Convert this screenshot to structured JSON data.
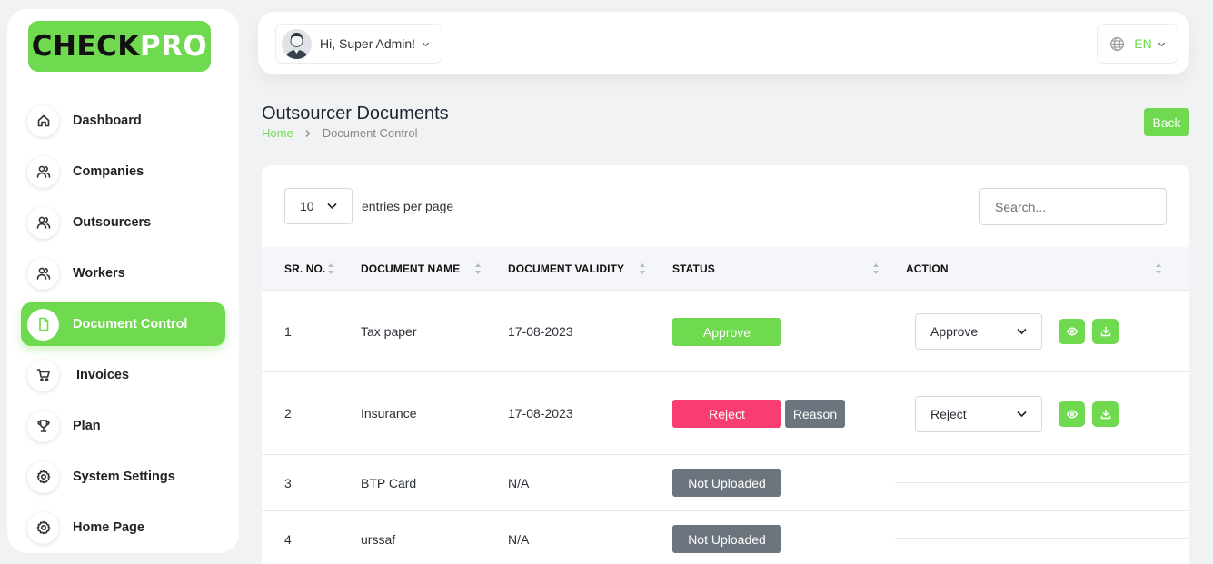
{
  "brand": {
    "part1": "CHECK",
    "part2": "PRO"
  },
  "sidebar": {
    "items": [
      {
        "label": "Dashboard",
        "icon": "home-icon"
      },
      {
        "label": "Companies",
        "icon": "users-icon"
      },
      {
        "label": "Outsourcers",
        "icon": "users-icon"
      },
      {
        "label": "Workers",
        "icon": "users-icon"
      },
      {
        "label": "Document Control",
        "icon": "file-icon",
        "active": true
      },
      {
        "label": "Invoices",
        "icon": "cart-icon"
      },
      {
        "label": "Plan",
        "icon": "trophy-icon"
      },
      {
        "label": "System Settings",
        "icon": "gear-icon"
      },
      {
        "label": "Home Page",
        "icon": "gear-icon"
      }
    ]
  },
  "topbar": {
    "greeting": "Hi, Super Admin!",
    "language": "EN"
  },
  "page": {
    "title": "Outsourcer Documents",
    "breadcrumb": {
      "home": "Home",
      "current": "Document Control"
    },
    "back_label": "Back"
  },
  "table_controls": {
    "entries_value": "10",
    "entries_label": "entries per page",
    "search_placeholder": "Search..."
  },
  "table": {
    "headers": [
      "SR. NO.",
      "DOCUMENT NAME",
      "DOCUMENT VALIDITY",
      "STATUS",
      "ACTION"
    ],
    "rows": [
      {
        "sr": "1",
        "name": "Tax paper",
        "validity": "17-08-2023",
        "status": "Approve",
        "action": "Approve"
      },
      {
        "sr": "2",
        "name": "Insurance",
        "validity": "17-08-2023",
        "status": "Reject",
        "reason": "Reason",
        "action": "Reject"
      },
      {
        "sr": "3",
        "name": "BTP Card",
        "validity": "N/A",
        "status": "Not Uploaded"
      },
      {
        "sr": "4",
        "name": "urssaf",
        "validity": "N/A",
        "status": "Not Uploaded"
      }
    ]
  },
  "colors": {
    "accent": "#6fd94f",
    "reject": "#f83d73",
    "neutral": "#6c757d"
  }
}
